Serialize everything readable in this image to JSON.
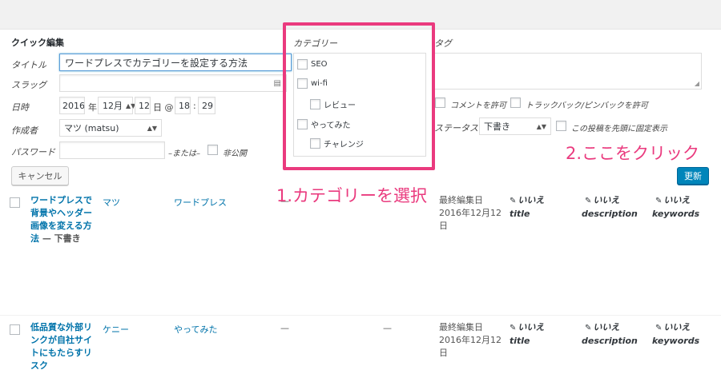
{
  "quick_edit": {
    "heading": "クイック編集",
    "title_label": "タイトル",
    "title_value": "ワードプレスでカテゴリーを設定する方法",
    "slug_label": "スラッグ",
    "slug_value": "",
    "date_label": "日時",
    "year": "2016",
    "year_unit": "年",
    "month": "12月",
    "day": "12",
    "day_unit": "日 @",
    "hour": "18",
    "colon": ":",
    "minute": "29",
    "author_label": "作成者",
    "author_value": "マツ (matsu)",
    "password_label": "パスワード",
    "or_text": "–または–",
    "private_label": "非公開",
    "cancel_label": "キャンセル",
    "update_label": "更新"
  },
  "categories": {
    "heading": "カテゴリー",
    "items": [
      {
        "label": "SEO"
      },
      {
        "label": "wi-fi"
      },
      {
        "label": "レビュー"
      },
      {
        "label": "やってみた"
      },
      {
        "label": "チャレンジ"
      }
    ]
  },
  "tags": {
    "heading": "タグ",
    "allow_comments": "コメントを許可",
    "allow_pings": "トラックバック/ピンバックを許可",
    "status_label": "ステータス",
    "status_value": "下書き",
    "sticky_label": "この投稿を先頭に固定表示"
  },
  "annotations": {
    "step1": "1.カテゴリーを選択",
    "step2": "2.ここをクリック"
  },
  "posts": [
    {
      "title": "ワードプレスで背景やヘッダー画像を変える方法",
      "state": " — 下書き",
      "author": "マツ",
      "category": "ワードプレス",
      "tags": "—",
      "comments": "—",
      "date_label": "最終編集日",
      "date_value": "2016年12月12日",
      "seo_title": "いいえ",
      "seo_title_key": "title",
      "seo_desc": "いいえ",
      "seo_desc_key": "description",
      "seo_kw": "いいえ",
      "seo_kw_key": "keywords"
    },
    {
      "title": "低品質な外部リンクが自社サイトにもたらすリスク",
      "state": "",
      "author": "ケニー",
      "category": "やってみた",
      "tags": "—",
      "comments": "—",
      "date_label": "最終編集日",
      "date_value": "2016年12月12日",
      "seo_title": "いいえ",
      "seo_title_key": "title",
      "seo_desc": "いいえ",
      "seo_desc_key": "description",
      "seo_kw": "いいえ",
      "seo_kw_key": "keywords"
    }
  ]
}
